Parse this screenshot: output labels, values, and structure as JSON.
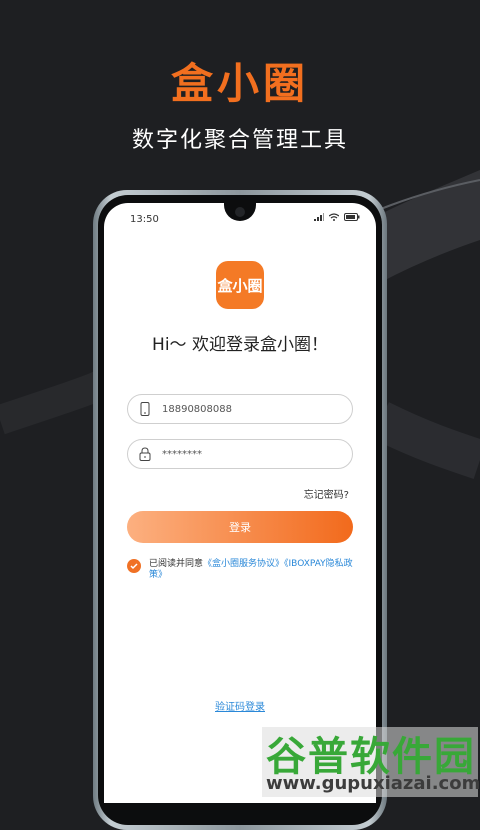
{
  "promo": {
    "title": "盒小圈",
    "subtitle": "数字化聚合管理工具"
  },
  "status_bar": {
    "time": "13:50",
    "icons": [
      "signal-icon",
      "wifi-icon",
      "battery-icon"
    ]
  },
  "app": {
    "logo_text": "盒小圈",
    "greeting": "Hi～ 欢迎登录盒小圈！"
  },
  "form": {
    "phone_value": "18890808088",
    "password_value": "********",
    "forgot_label": "忘记密码?",
    "login_label": "登录"
  },
  "agreement": {
    "prefix": "已阅读并同意",
    "link_service": "《盒小圈服务协议》",
    "link_privacy": "《IBOXPAY隐私政策》",
    "checked": true
  },
  "sms_login_label": "验证码登录",
  "watermark": {
    "title": "谷普软件园",
    "url": "www.gupuxiazai.com"
  },
  "colors": {
    "accent": "#f26f1f",
    "link": "#2a88d8",
    "background": "#1e1f22"
  }
}
